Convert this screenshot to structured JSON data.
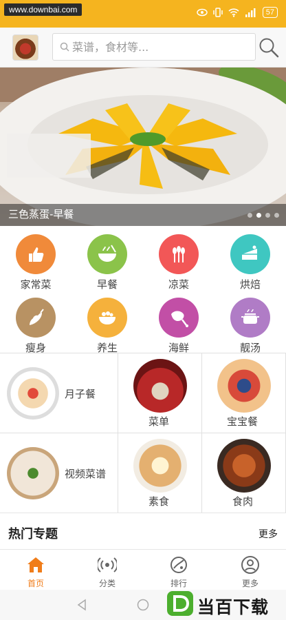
{
  "status_bar": {
    "watermark": "www.downbai.com",
    "battery": "57"
  },
  "search": {
    "placeholder": "菜谱，食材等..."
  },
  "banner": {
    "title": "三色蒸蛋-早餐",
    "slide_count": 4,
    "active_slide": 1
  },
  "categories": [
    {
      "label": "家常菜",
      "color": "#f08a3a",
      "icon": "thumbs-up-icon"
    },
    {
      "label": "早餐",
      "color": "#8bc34a",
      "icon": "bowl-icon"
    },
    {
      "label": "凉菜",
      "color": "#f25757",
      "icon": "wheat-icon"
    },
    {
      "label": "烘焙",
      "color": "#3fc7c1",
      "icon": "cake-icon"
    },
    {
      "label": "瘦身",
      "color": "#b89263",
      "icon": "pepper-icon"
    },
    {
      "label": "养生",
      "color": "#f5b13c",
      "icon": "hot-pot-icon"
    },
    {
      "label": "海鲜",
      "color": "#c24fa6",
      "icon": "ham-icon"
    },
    {
      "label": "靓汤",
      "color": "#b07cc6",
      "icon": "soup-pot-icon"
    }
  ],
  "features": [
    {
      "label": "月子餐"
    },
    {
      "label": "菜单"
    },
    {
      "label": "宝宝餐"
    },
    {
      "label": "视频菜谱"
    },
    {
      "label": "素食"
    },
    {
      "label": "食肉"
    }
  ],
  "section": {
    "title": "热门专题",
    "more": "更多"
  },
  "tabs": [
    {
      "label": "首页",
      "icon": "home-icon",
      "active": true
    },
    {
      "label": "分类",
      "icon": "broadcast-icon",
      "active": false
    },
    {
      "label": "排行",
      "icon": "ranking-icon",
      "active": false
    },
    {
      "label": "更多",
      "icon": "user-icon",
      "active": false
    }
  ],
  "brand": {
    "text": "当百下载"
  },
  "colors": {
    "status_bar": "#f5b41f",
    "accent": "#f07d1a"
  }
}
